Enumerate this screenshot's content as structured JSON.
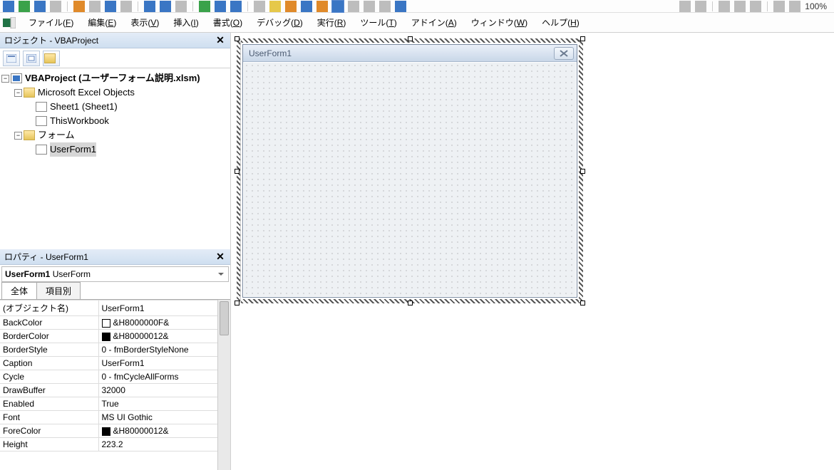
{
  "toolbar": {
    "zoom": "100%"
  },
  "menu": {
    "file": {
      "pre": "ファイル(",
      "u": "F",
      "post": ")"
    },
    "edit": {
      "pre": "編集(",
      "u": "E",
      "post": ")"
    },
    "view": {
      "pre": "表示(",
      "u": "V",
      "post": ")"
    },
    "insert": {
      "pre": "挿入(",
      "u": "I",
      "post": ")"
    },
    "format": {
      "pre": "書式(",
      "u": "O",
      "post": ")"
    },
    "debug": {
      "pre": "デバッグ(",
      "u": "D",
      "post": ")"
    },
    "run": {
      "pre": "実行(",
      "u": "R",
      "post": ")"
    },
    "tools": {
      "pre": "ツール(",
      "u": "T",
      "post": ")"
    },
    "addins": {
      "pre": "アドイン(",
      "u": "A",
      "post": ")"
    },
    "window": {
      "pre": "ウィンドウ(",
      "u": "W",
      "post": ")"
    },
    "help": {
      "pre": "ヘルプ(",
      "u": "H",
      "post": ")"
    }
  },
  "project_panel": {
    "title": "ロジェクト - VBAProject",
    "tree": {
      "root": "VBAProject (ユーザーフォーム説明.xlsm)",
      "excel_objects": "Microsoft Excel Objects",
      "sheet1": "Sheet1 (Sheet1)",
      "thiswb": "ThisWorkbook",
      "forms": "フォーム",
      "userform": "UserForm1"
    }
  },
  "properties_panel": {
    "title": "ロパティ - UserForm1",
    "object_name": "UserForm1",
    "object_type": "UserForm",
    "tab_all": "全体",
    "tab_cat": "項目別",
    "rows": {
      "name": {
        "k": "(オブジェクト名)",
        "v": "UserForm1"
      },
      "backcolor": {
        "k": "BackColor",
        "v": "&H8000000F&",
        "swatch": "#ffffff"
      },
      "bordercolor": {
        "k": "BorderColor",
        "v": "&H80000012&",
        "swatch": "#000000"
      },
      "borderstyle": {
        "k": "BorderStyle",
        "v": "0 - fmBorderStyleNone"
      },
      "caption": {
        "k": "Caption",
        "v": "UserForm1"
      },
      "cycle": {
        "k": "Cycle",
        "v": "0 - fmCycleAllForms"
      },
      "drawbuffer": {
        "k": "DrawBuffer",
        "v": "32000"
      },
      "enabled": {
        "k": "Enabled",
        "v": "True"
      },
      "font": {
        "k": "Font",
        "v": "MS UI Gothic"
      },
      "forecolor": {
        "k": "ForeColor",
        "v": "&H80000012&",
        "swatch": "#000000"
      },
      "height": {
        "k": "Height",
        "v": "223.2"
      }
    }
  },
  "form": {
    "caption": "UserForm1"
  }
}
